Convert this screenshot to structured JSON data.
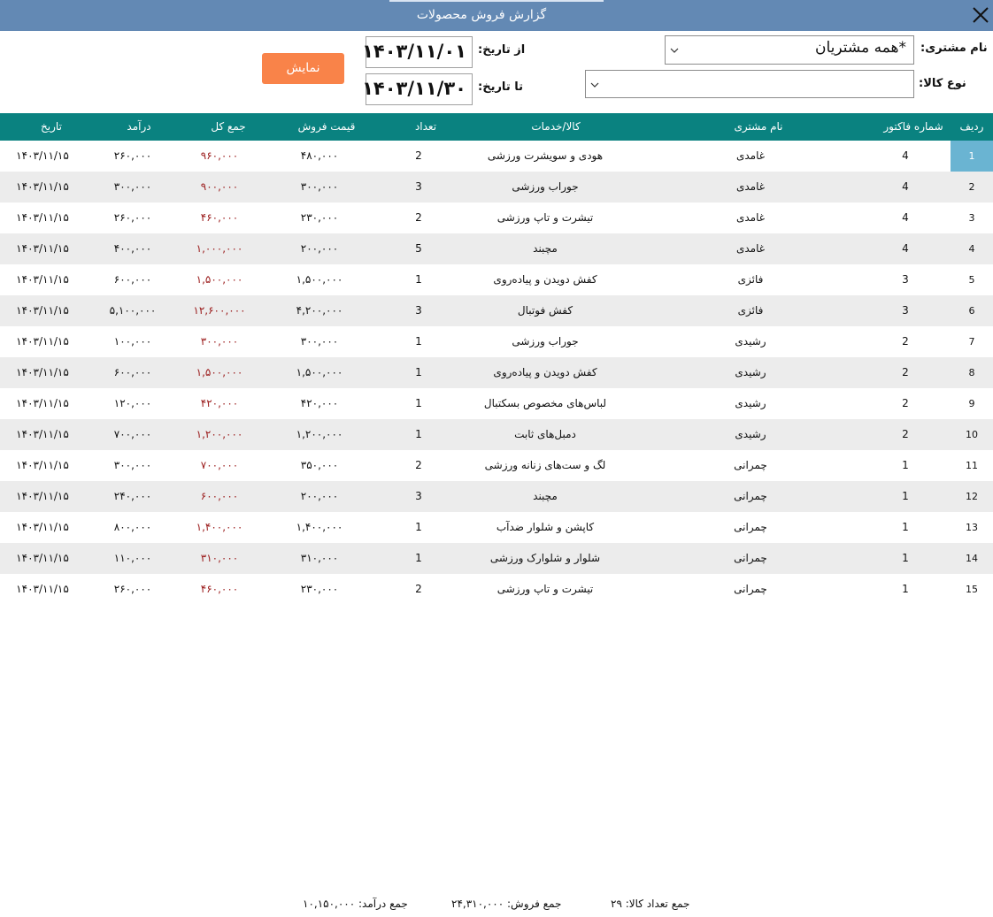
{
  "window": {
    "title": "گزارش فروش محصولات",
    "close_icon": "close-icon"
  },
  "filters": {
    "customer_label": "نام مشتری:",
    "customer_value": "*همه مشتریان",
    "product_type_label": "نوع کالا:",
    "product_type_value": "",
    "from_date_label": "از تاریخ:",
    "from_date_value": "۱۴۰۳/۱۱/۰۱",
    "to_date_label": "تا تاریخ:",
    "to_date_value": "۱۴۰۳/۱۱/۳۰",
    "show_button": "نمایش"
  },
  "table": {
    "columns": [
      "ردیف",
      "شماره فاکتور",
      "نام مشتری",
      "کالا/خدمات",
      "تعداد",
      "قیمت فروش",
      "جمع کل",
      "درآمد",
      "تاریخ"
    ],
    "selected_row": 1,
    "rows": [
      {
        "idx": "1",
        "invoice": "4",
        "customer": "غامدی",
        "product": "هودی و سویشرت ورزشی",
        "qty": "2",
        "price": "۴۸۰,۰۰۰",
        "total": "۹۶۰,۰۰۰",
        "income": "۲۶۰,۰۰۰",
        "date": "۱۴۰۳/۱۱/۱۵"
      },
      {
        "idx": "2",
        "invoice": "4",
        "customer": "غامدی",
        "product": "جوراب ورزشی",
        "qty": "3",
        "price": "۳۰۰,۰۰۰",
        "total": "۹۰۰,۰۰۰",
        "income": "۳۰۰,۰۰۰",
        "date": "۱۴۰۳/۱۱/۱۵"
      },
      {
        "idx": "3",
        "invoice": "4",
        "customer": "غامدی",
        "product": "تیشرت و تاپ ورزشی",
        "qty": "2",
        "price": "۲۳۰,۰۰۰",
        "total": "۴۶۰,۰۰۰",
        "income": "۲۶۰,۰۰۰",
        "date": "۱۴۰۳/۱۱/۱۵"
      },
      {
        "idx": "4",
        "invoice": "4",
        "customer": "غامدی",
        "product": "مچبند",
        "qty": "5",
        "price": "۲۰۰,۰۰۰",
        "total": "۱,۰۰۰,۰۰۰",
        "income": "۴۰۰,۰۰۰",
        "date": "۱۴۰۳/۱۱/۱۵"
      },
      {
        "idx": "5",
        "invoice": "3",
        "customer": "فائزی",
        "product": "کفش دویدن و پیاده‌روی",
        "qty": "1",
        "price": "۱,۵۰۰,۰۰۰",
        "total": "۱,۵۰۰,۰۰۰",
        "income": "۶۰۰,۰۰۰",
        "date": "۱۴۰۳/۱۱/۱۵"
      },
      {
        "idx": "6",
        "invoice": "3",
        "customer": "فائزی",
        "product": "کفش فوتبال",
        "qty": "3",
        "price": "۴,۲۰۰,۰۰۰",
        "total": "۱۲,۶۰۰,۰۰۰",
        "income": "۵,۱۰۰,۰۰۰",
        "date": "۱۴۰۳/۱۱/۱۵"
      },
      {
        "idx": "7",
        "invoice": "2",
        "customer": "رشیدی",
        "product": "جوراب ورزشی",
        "qty": "1",
        "price": "۳۰۰,۰۰۰",
        "total": "۳۰۰,۰۰۰",
        "income": "۱۰۰,۰۰۰",
        "date": "۱۴۰۳/۱۱/۱۵"
      },
      {
        "idx": "8",
        "invoice": "2",
        "customer": "رشیدی",
        "product": "کفش دویدن و پیاده‌روی",
        "qty": "1",
        "price": "۱,۵۰۰,۰۰۰",
        "total": "۱,۵۰۰,۰۰۰",
        "income": "۶۰۰,۰۰۰",
        "date": "۱۴۰۳/۱۱/۱۵"
      },
      {
        "idx": "9",
        "invoice": "2",
        "customer": "رشیدی",
        "product": "لباس‌های مخصوص بسکتبال",
        "qty": "1",
        "price": "۴۲۰,۰۰۰",
        "total": "۴۲۰,۰۰۰",
        "income": "۱۲۰,۰۰۰",
        "date": "۱۴۰۳/۱۱/۱۵"
      },
      {
        "idx": "10",
        "invoice": "2",
        "customer": "رشیدی",
        "product": "دمبل‌های ثابت",
        "qty": "1",
        "price": "۱,۲۰۰,۰۰۰",
        "total": "۱,۲۰۰,۰۰۰",
        "income": "۷۰۰,۰۰۰",
        "date": "۱۴۰۳/۱۱/۱۵"
      },
      {
        "idx": "11",
        "invoice": "1",
        "customer": "چمرانی",
        "product": "لگ و ست‌های زنانه ورزشی",
        "qty": "2",
        "price": "۳۵۰,۰۰۰",
        "total": "۷۰۰,۰۰۰",
        "income": "۳۰۰,۰۰۰",
        "date": "۱۴۰۳/۱۱/۱۵"
      },
      {
        "idx": "12",
        "invoice": "1",
        "customer": "چمرانی",
        "product": "مچبند",
        "qty": "3",
        "price": "۲۰۰,۰۰۰",
        "total": "۶۰۰,۰۰۰",
        "income": "۲۴۰,۰۰۰",
        "date": "۱۴۰۳/۱۱/۱۵"
      },
      {
        "idx": "13",
        "invoice": "1",
        "customer": "چمرانی",
        "product": "کاپشن و شلوار ضدآب",
        "qty": "1",
        "price": "۱,۴۰۰,۰۰۰",
        "total": "۱,۴۰۰,۰۰۰",
        "income": "۸۰۰,۰۰۰",
        "date": "۱۴۰۳/۱۱/۱۵"
      },
      {
        "idx": "14",
        "invoice": "1",
        "customer": "چمرانی",
        "product": "شلوار و شلوارک ورزشی",
        "qty": "1",
        "price": "۳۱۰,۰۰۰",
        "total": "۳۱۰,۰۰۰",
        "income": "۱۱۰,۰۰۰",
        "date": "۱۴۰۳/۱۱/۱۵"
      },
      {
        "idx": "15",
        "invoice": "1",
        "customer": "چمرانی",
        "product": "تیشرت و تاپ ورزشی",
        "qty": "2",
        "price": "۲۳۰,۰۰۰",
        "total": "۴۶۰,۰۰۰",
        "income": "۲۶۰,۰۰۰",
        "date": "۱۴۰۳/۱۱/۱۵"
      }
    ]
  },
  "footer": {
    "total_qty": "جمع تعداد کالا: ۲۹",
    "total_sales": "جمع فروش: ۲۴,۳۱۰,۰۰۰",
    "total_income": "جمع درآمد: ۱۰,۱۵۰,۰۰۰"
  },
  "colors": {
    "titlebar": "#6389b4",
    "grid_header": "#0a8280",
    "show_button": "#f98349",
    "selected_row": "#6ab4d2",
    "total_text": "#9b1c1c"
  }
}
